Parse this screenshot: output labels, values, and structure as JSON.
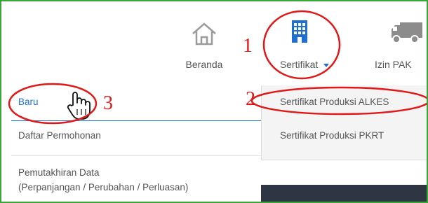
{
  "nav": {
    "beranda_label": "Beranda",
    "sertifikat_label": "Sertifikat",
    "izin_pak_label": "Izin PAK"
  },
  "submenu_left": {
    "items": [
      {
        "label": "Baru"
      },
      {
        "label": "Daftar Permohonan"
      },
      {
        "label": "Pemutakhiran Data"
      },
      {
        "label": "(Perpanjangan / Perubahan / Perluasan)"
      }
    ]
  },
  "submenu_right": {
    "items": [
      {
        "label": "Sertifikat Produksi ALKES"
      },
      {
        "label": "Sertifikat Produksi PKRT"
      }
    ]
  },
  "annotations": {
    "step1": "1",
    "step2": "2",
    "step3": "3"
  },
  "colors": {
    "accent_blue": "#1f6fd1",
    "annotation_red": "#e01818",
    "frame_green": "#3aa63a"
  },
  "icons": [
    "home-icon",
    "building-icon",
    "truck-icon",
    "hand-cursor-icon"
  ]
}
